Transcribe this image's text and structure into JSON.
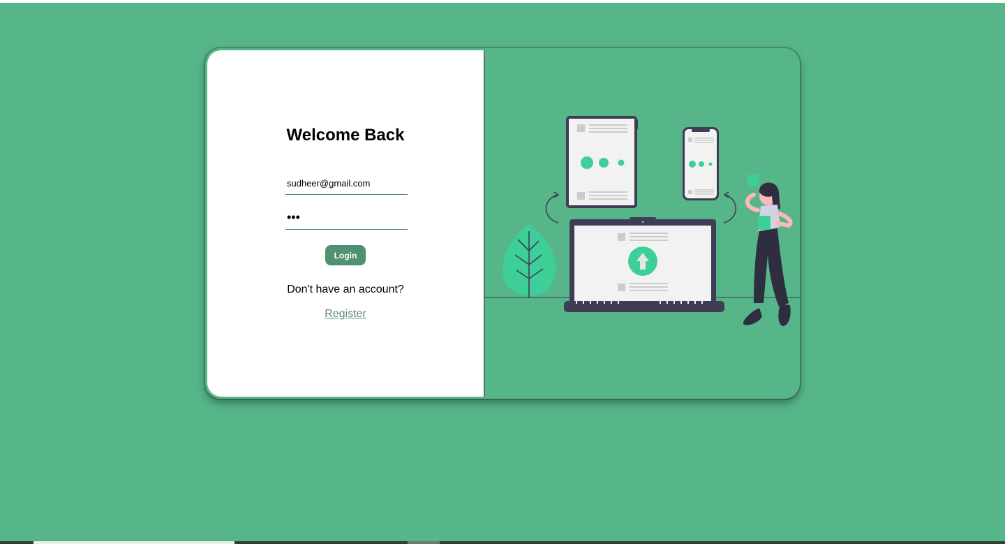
{
  "login": {
    "heading": "Welcome Back",
    "email_value": "sudheer@gmail.com",
    "password_value": "•••",
    "button_label": "Login",
    "prompt_text": "Don't have an account?",
    "register_link": "Register"
  },
  "colors": {
    "page_background": "#56b689",
    "button": "#4f9170",
    "link": "#5a8a84",
    "illustration_accent": "#3ecf99",
    "illustration_dark": "#3f3d56"
  },
  "illustration": {
    "icons": [
      "tablet-icon",
      "phone-icon",
      "laptop-icon",
      "upload-arrow-icon",
      "leaf-icon",
      "person-icon"
    ]
  }
}
